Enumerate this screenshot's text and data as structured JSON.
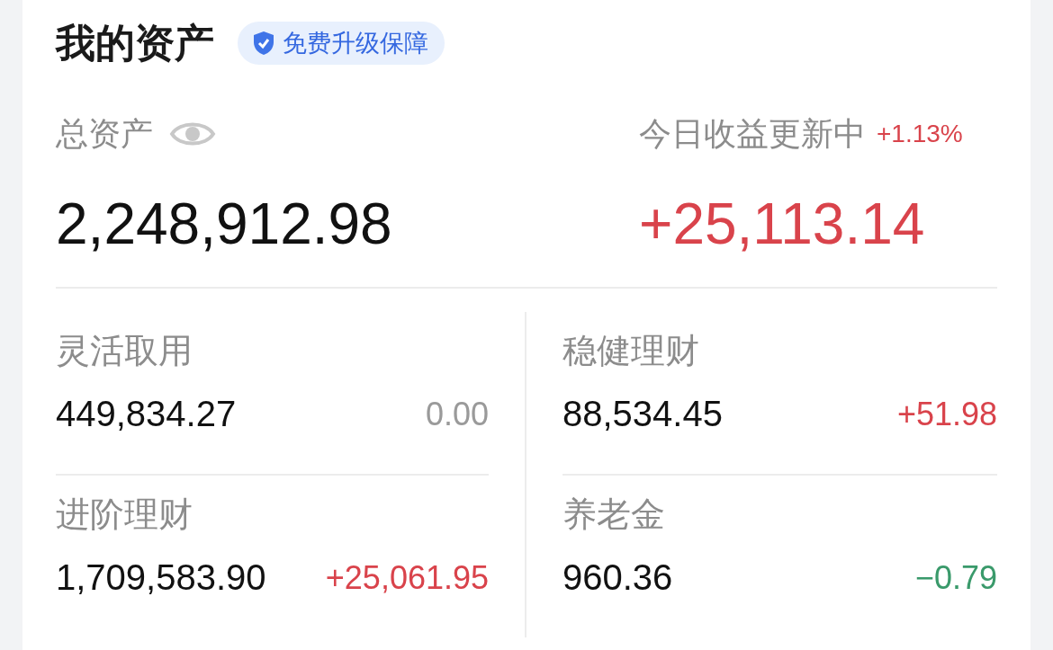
{
  "title": "我的资产",
  "badge": {
    "label": "免费升级保障"
  },
  "total": {
    "label": "总资产",
    "value": "2,248,912.98"
  },
  "today": {
    "label": "今日收益更新中",
    "rate": "+1.13%",
    "value": "+25,113.14"
  },
  "holdings": [
    {
      "name": "灵活取用",
      "value": "449,834.27",
      "change": "0.00",
      "color": "#9a9a9a"
    },
    {
      "name": "稳健理财",
      "value": "88,534.45",
      "change": "+51.98",
      "color": "#d9434b"
    },
    {
      "name": "进阶理财",
      "value": "1,709,583.90",
      "change": "+25,061.95",
      "color": "#d9434b"
    },
    {
      "name": "养老金",
      "value": "960.36",
      "change": "−0.79",
      "color": "#3a9a6b"
    }
  ]
}
